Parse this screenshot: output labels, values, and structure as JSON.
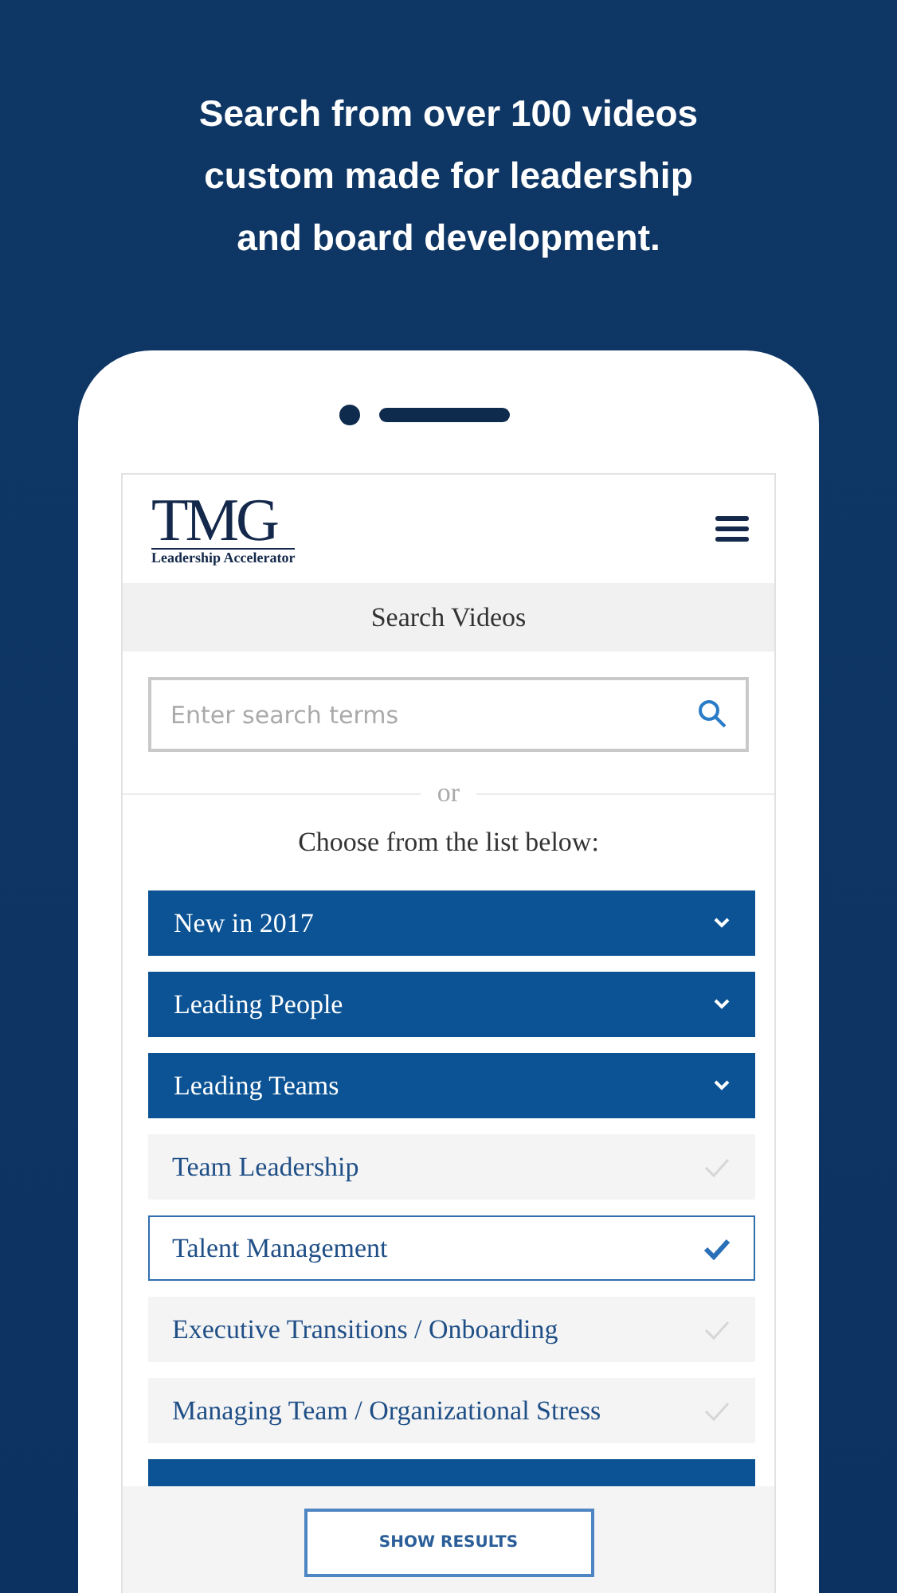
{
  "headline": [
    "Search from over 100 videos",
    "custom made for leadership",
    "and board development."
  ],
  "logo": {
    "mark": "TMG",
    "tagline": "Leadership Accelerator"
  },
  "section_title": "Search Videos",
  "search": {
    "placeholder": "Enter search terms"
  },
  "divider_text": "or",
  "list_prompt": "Choose from the list below:",
  "categories": [
    {
      "kind": "category",
      "label": "New in 2017"
    },
    {
      "kind": "category",
      "label": "Leading People"
    },
    {
      "kind": "category",
      "label": "Leading Teams",
      "children": [
        {
          "label": "Team Leadership",
          "selected": false
        },
        {
          "label": "Talent Management",
          "selected": true
        },
        {
          "label": "Executive Transitions / Onboarding",
          "selected": false
        },
        {
          "label": "Managing Team / Organizational Stress",
          "selected": false
        }
      ]
    },
    {
      "kind": "cut"
    }
  ],
  "footer_button": "SHOW RESULTS"
}
